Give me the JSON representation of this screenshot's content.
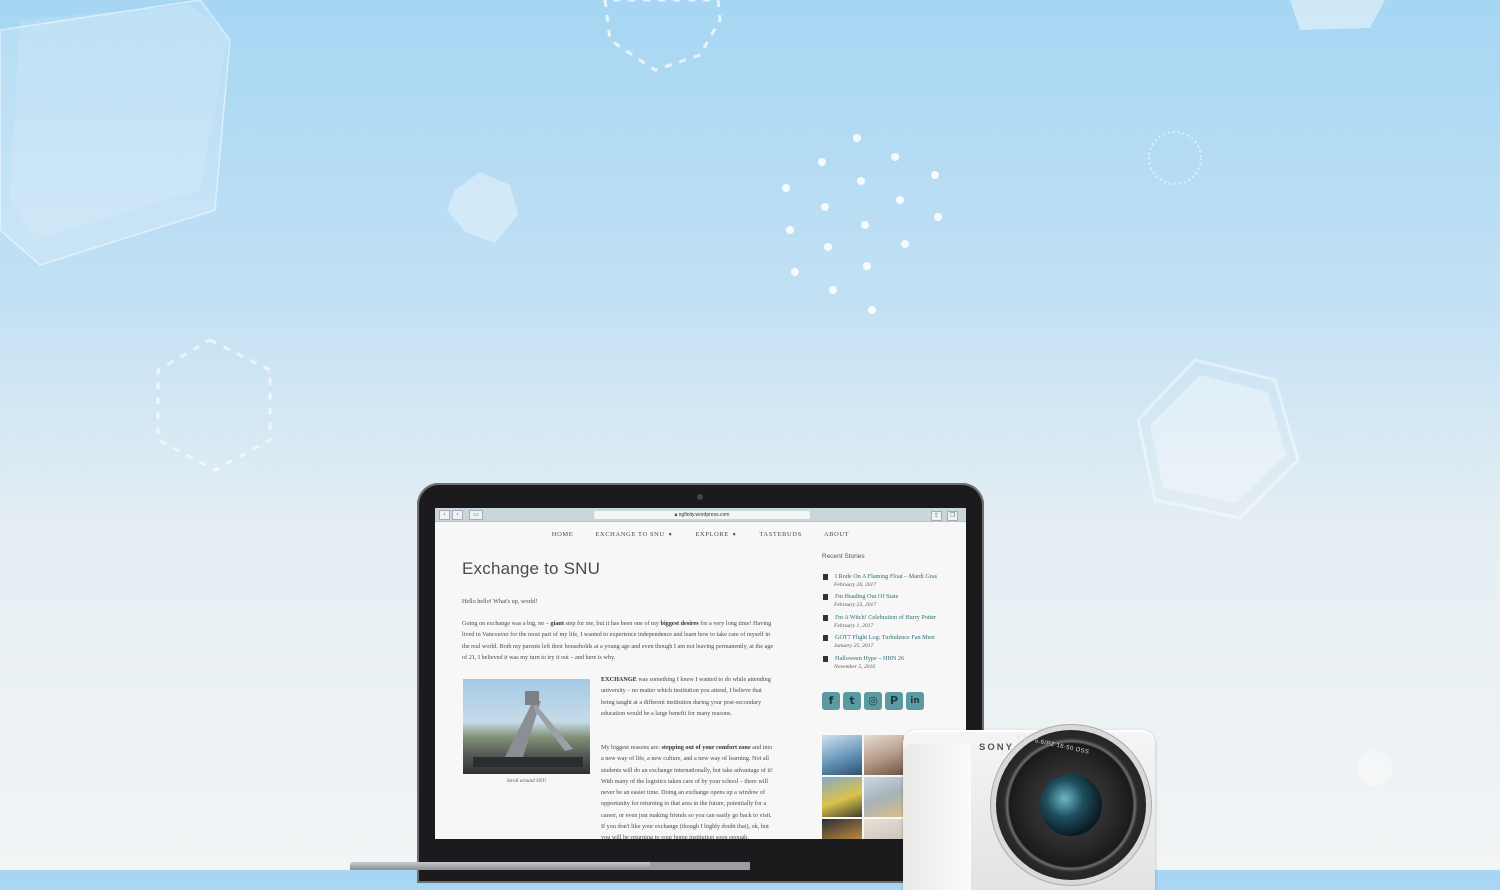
{
  "browser": {
    "url": "ngfinity.wordpress.com"
  },
  "nav": {
    "items": [
      {
        "label": "HOME",
        "has_dropdown": false
      },
      {
        "label": "EXCHANGE TO SNU",
        "has_dropdown": true
      },
      {
        "label": "EXPLORE",
        "has_dropdown": true
      },
      {
        "label": "TASTEBUDS",
        "has_dropdown": false
      },
      {
        "label": "ABOUT",
        "has_dropdown": false
      }
    ]
  },
  "post": {
    "title": "Exchange to SNU",
    "greeting": "Hello hello! What's up, world!",
    "p1_a": "Going on exchange was a big, no – ",
    "p1_b": "giant",
    "p1_c": " step for me, but it has been one of my ",
    "p1_d": "biggest desires",
    "p1_e": " for a very long time! Having lived in Vancouver for the most part of my life, I wanted to experience independence and learn how to take care of myself in the real world. Both my parents left their households at a young age and even though I am not leaving permanently, at the age of 21, I believed it was my turn to try it out – and here is why.",
    "p2_a": "EXCHANGE",
    "p2_b": " was something I knew I wanted to do while attending university – no matter which institution you attend, I believe that being taught at a different institution during your post-secondary education would be a large benefit for many reasons.",
    "p3_a": "My biggest reasons are: ",
    "p3_b": "stepping out of your comfort zone",
    "p3_c": " and into a new way of life, a new culture, and a new way of learning. Not all students will do an exchange internationally, but take advantage of it! With many of the logistics taken care of by your school – there will never be an easier time. Doing an exchange opens up a window of opportunity for returning to that area in the future, potentially for a career, or even just making friends so you can easily go back to visit. If you don't like your exchange (though I highly doubt that), ok, but you will be returning to your home institution soon enough.",
    "image_caption": "Stroll around SNU"
  },
  "sidebar": {
    "title": "Recent Stories",
    "stories": [
      {
        "title": "I Rode On A Flaming Float – Mardi Gras",
        "date": "February 26, 2017"
      },
      {
        "title": "I'm Heading Out Of State",
        "date": "February 23, 2017"
      },
      {
        "title": "I'm A Witch! Celebration of Harry Potter",
        "date": "February 1, 2017"
      },
      {
        "title": "GOT7 Flight Log: Turbulence Fan Meet",
        "date": "January 25, 2017"
      },
      {
        "title": "Halloween Hype – HHN 26",
        "date": "November 5, 2016"
      }
    ],
    "social": [
      {
        "name": "facebook-icon",
        "glyph": "f"
      },
      {
        "name": "twitter-icon",
        "glyph": "t"
      },
      {
        "name": "instagram-icon",
        "glyph": "◎"
      },
      {
        "name": "pinterest-icon",
        "glyph": "P"
      },
      {
        "name": "linkedin-icon",
        "glyph": "in"
      }
    ]
  },
  "camera": {
    "brand": "SONY",
    "lens_label": "E 3.5-5.6/PZ 16-50 OSS"
  },
  "colors": {
    "accent": "#5b9aa1",
    "link": "#2f6c75",
    "background_top": "#a6d6f3"
  }
}
